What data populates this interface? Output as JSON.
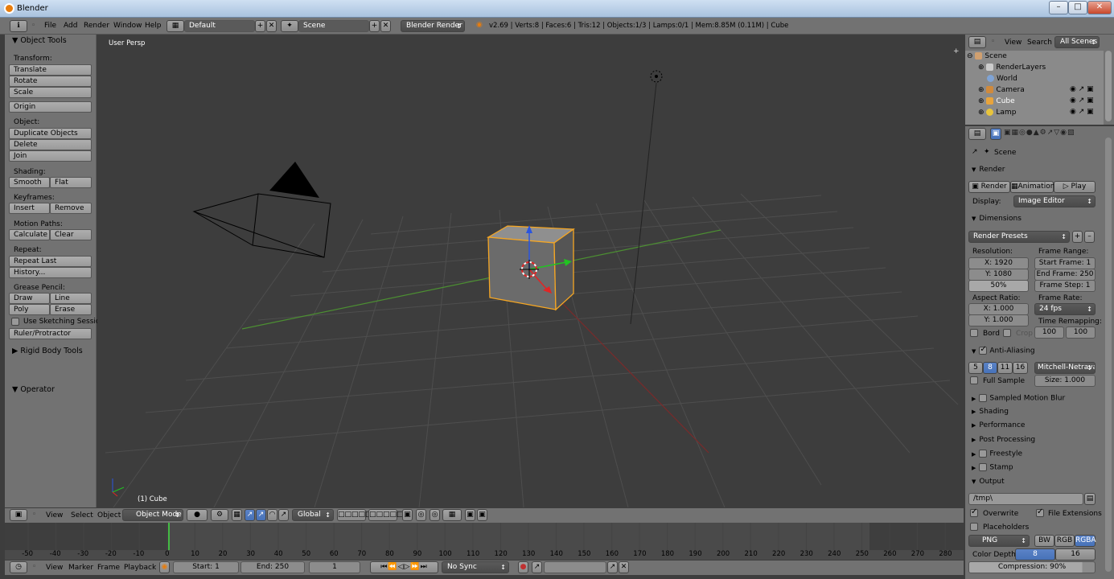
{
  "window": {
    "title": "Blender"
  },
  "info_header": {
    "menus": [
      "File",
      "Add",
      "Render",
      "Window",
      "Help"
    ],
    "layout": "Default",
    "scene": "Scene",
    "engine": "Blender Render",
    "stats": "v2.69 | Verts:8 | Faces:6 | Tris:12 | Objects:1/3 | Lamps:0/1 | Mem:8.85M (0.11M) | Cube"
  },
  "toolshelf": {
    "title": "Object Tools",
    "transform_label": "Transform:",
    "translate": "Translate",
    "rotate": "Rotate",
    "scale": "Scale",
    "origin": "Origin",
    "object_label": "Object:",
    "duplicate": "Duplicate Objects",
    "delete": "Delete",
    "join": "Join",
    "shading_label": "Shading:",
    "smooth": "Smooth",
    "flat": "Flat",
    "keyframes_label": "Keyframes:",
    "insert": "Insert",
    "remove": "Remove",
    "motion_label": "Motion Paths:",
    "calculate": "Calculate",
    "clear": "Clear",
    "repeat_label": "Repeat:",
    "repeat_last": "Repeat Last",
    "history": "History...",
    "grease_label": "Grease Pencil:",
    "draw": "Draw",
    "line": "Line",
    "poly": "Poly",
    "erase": "Erase",
    "sketching": "Use Sketching Sessions",
    "ruler": "Ruler/Protractor",
    "rigid": "Rigid Body Tools",
    "operator": "Operator"
  },
  "viewport": {
    "view_name": "User Persp",
    "object_name": "(1) Cube"
  },
  "viewport_header": {
    "menus": [
      "View",
      "Select",
      "Object"
    ],
    "mode": "Object Mode",
    "orientation": "Global"
  },
  "outliner": {
    "menus": [
      "View",
      "Search"
    ],
    "filter": "All Scenes",
    "items": [
      "Scene",
      "RenderLayers",
      "World",
      "Camera",
      "Cube",
      "Lamp"
    ]
  },
  "properties": {
    "context": "Scene",
    "render_title": "Render",
    "render_btn": "Render",
    "animation_btn": "Animation",
    "play_btn": "Play",
    "display_label": "Display:",
    "display_value": "Image Editor",
    "dimensions_title": "Dimensions",
    "presets": "Render Presets",
    "resolution_label": "Resolution:",
    "res_x": "X: 1920",
    "res_y": "Y: 1080",
    "res_pct": "50%",
    "frame_range_label": "Frame Range:",
    "start_frame": "Start Frame: 1",
    "end_frame": "End Frame: 250",
    "frame_step": "Frame Step: 1",
    "aspect_label": "Aspect Ratio:",
    "asp_x": "X: 1.000",
    "asp_y": "Y: 1.000",
    "frame_rate_label": "Frame Rate:",
    "fps": "24 fps",
    "time_remap_label": "Time Remapping:",
    "remap_old": "100",
    "remap_new": "100",
    "bord": "Bord",
    "crop": "Crop",
    "aa_title": "Anti-Aliasing",
    "aa_samples": [
      "5",
      "8",
      "11",
      "16"
    ],
    "aa_filter": "Mitchell-Netravali",
    "full_sample": "Full Sample",
    "size": "Size: 1.000",
    "sampled_mb": "Sampled Motion Blur",
    "shading": "Shading",
    "performance": "Performance",
    "post": "Post Processing",
    "freestyle": "Freestyle",
    "stamp": "Stamp",
    "output_title": "Output",
    "output_path": "/tmp\\",
    "overwrite": "Overwrite",
    "file_ext": "File Extensions",
    "placeholders": "Placeholders",
    "format": "PNG",
    "bw": "BW",
    "rgb": "RGB",
    "rgba": "RGBA",
    "color_depth_label": "Color Depth:",
    "depth_8": "8",
    "depth_16": "16",
    "compression": "Compression: 90%"
  },
  "timeline": {
    "ticks": [
      "-50",
      "-40",
      "-30",
      "-20",
      "-10",
      "0",
      "10",
      "20",
      "30",
      "40",
      "50",
      "60",
      "70",
      "80",
      "90",
      "100",
      "110",
      "120",
      "130",
      "140",
      "150",
      "160",
      "170",
      "180",
      "190",
      "200",
      "210",
      "220",
      "230",
      "240",
      "250",
      "260",
      "270",
      "280"
    ]
  },
  "timeline_header": {
    "menus": [
      "View",
      "Marker",
      "Frame",
      "Playback"
    ],
    "start": "Start: 1",
    "end": "End: 250",
    "current": "1",
    "sync": "No Sync"
  },
  "colors": {
    "accent": "#5680c2",
    "select": "#f5a623",
    "grid": "#4e4e4e"
  }
}
